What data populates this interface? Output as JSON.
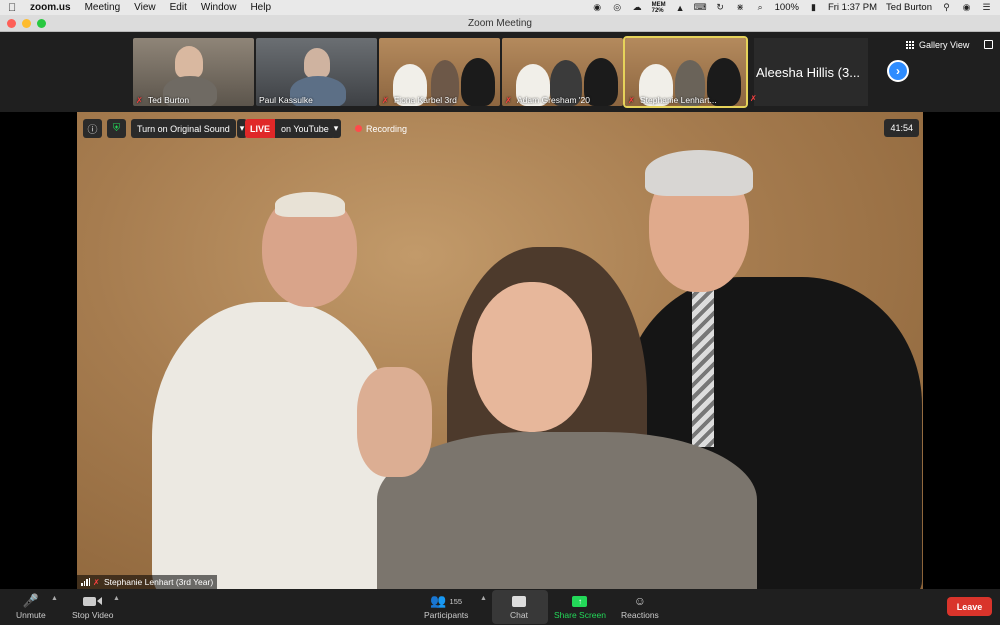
{
  "menubar": {
    "app": "zoom.us",
    "items": [
      "Meeting",
      "View",
      "Edit",
      "Window",
      "Help"
    ],
    "memory_label": "MEM",
    "memory_value": "72%",
    "battery": "100%",
    "clock": "Fri 1:37 PM",
    "user": "Ted Burton"
  },
  "window": {
    "title": "Zoom Meeting"
  },
  "gallery": {
    "view_label": "Gallery View",
    "thumbnails": [
      {
        "name": "Ted Burton"
      },
      {
        "name": "Paul Kassulke"
      },
      {
        "name": "Fiona Karbel 3rd"
      },
      {
        "name": "Adam Gresham '20"
      },
      {
        "name": "Stephanie Lenhart..."
      }
    ],
    "name_tile": "Aleesha Hillis (3..."
  },
  "video": {
    "original_sound": "Turn on Original Sound",
    "live_badge": "LIVE",
    "live_platform": "on YouTube",
    "recording": "Recording",
    "timer": "41:54",
    "speaker": "Stephanie Lenhart (3rd Year)"
  },
  "toolbar": {
    "unmute": "Unmute",
    "stop_video": "Stop Video",
    "participants": "Participants",
    "participant_count": "155",
    "chat": "Chat",
    "share_screen": "Share Screen",
    "reactions": "Reactions",
    "leave": "Leave"
  },
  "colors": {
    "accent": "#2d8cff",
    "live": "#e02828",
    "share": "#23d959",
    "leave": "#d9342b",
    "active_border": "#e6d35a"
  }
}
